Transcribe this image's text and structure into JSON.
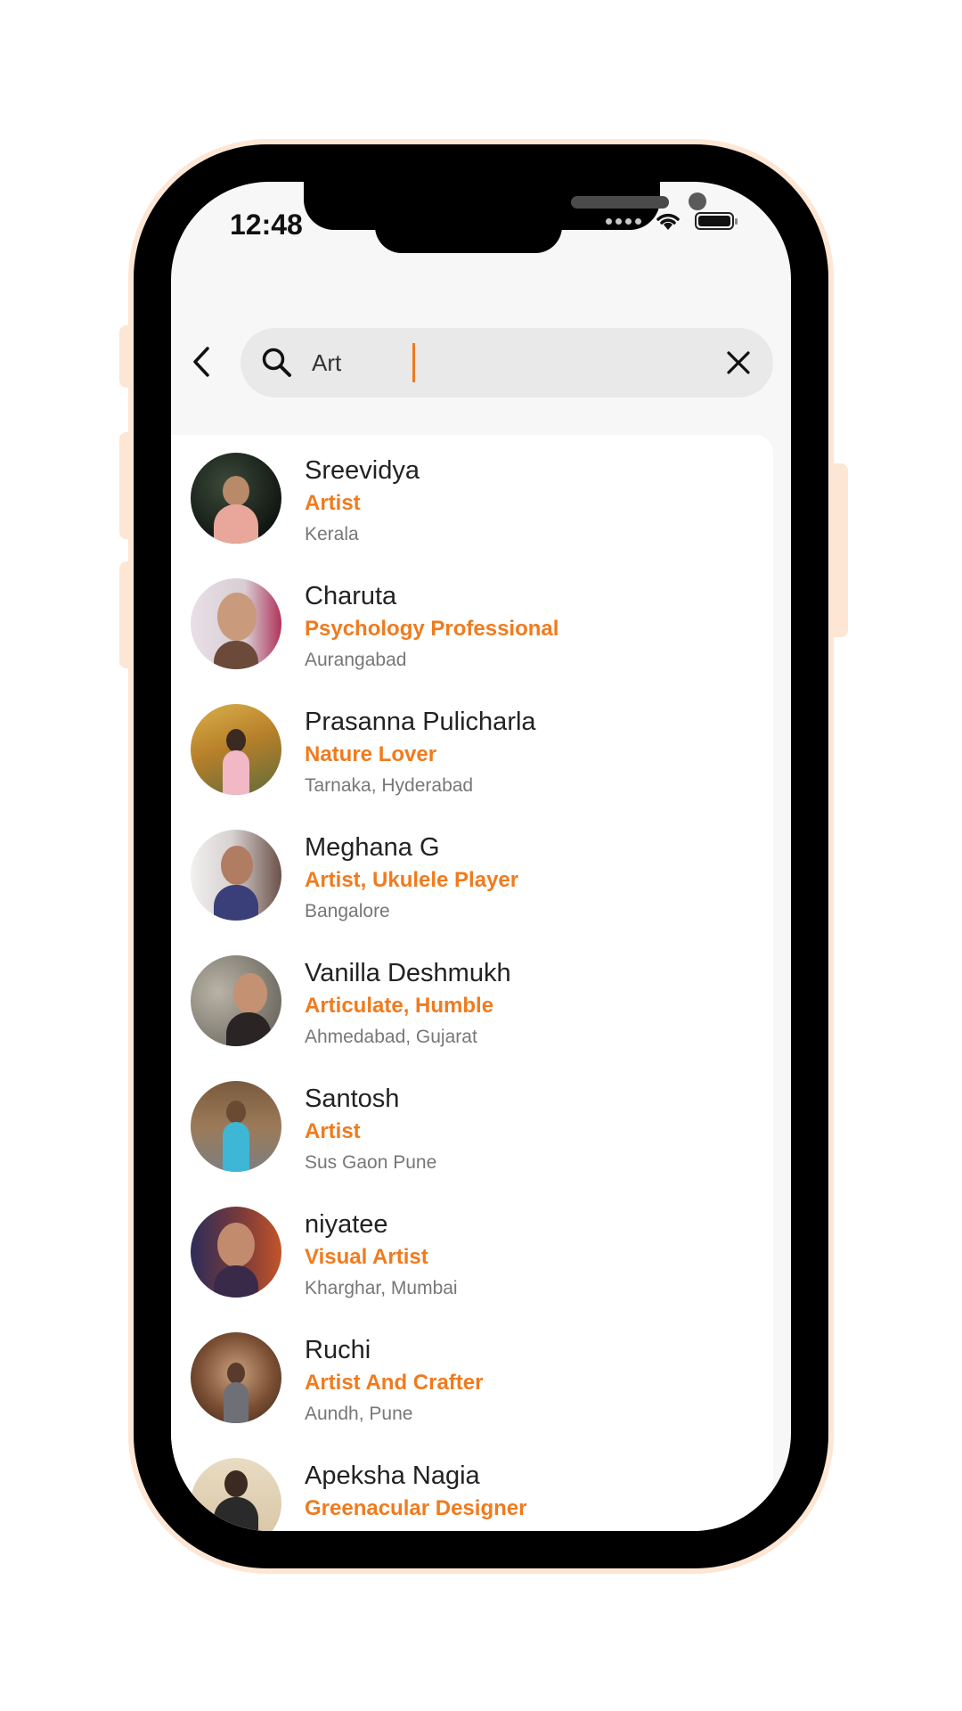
{
  "status_bar": {
    "time": "12:48"
  },
  "search": {
    "query": "Art",
    "placeholder": ""
  },
  "icons": {
    "back": "chevron-left-icon",
    "search": "search-icon",
    "clear": "close-icon"
  },
  "colors": {
    "accent": "#f07b1e",
    "name_text": "#222222",
    "location_text": "#777777",
    "search_bg": "#e9e9e9",
    "frame_glow": "#fde6d4"
  },
  "results": [
    {
      "name": "Sreevidya",
      "role": "Artist",
      "location": "Kerala"
    },
    {
      "name": "Charuta",
      "role": "Psychology Professional",
      "location": "Aurangabad"
    },
    {
      "name": "Prasanna Pulicharla",
      "role": "Nature Lover",
      "location": "Tarnaka, Hyderabad"
    },
    {
      "name": "Meghana G",
      "role": "Artist, Ukulele Player",
      "location": "Bangalore"
    },
    {
      "name": "Vanilla Deshmukh",
      "role": "Articulate, Humble",
      "location": "Ahmedabad, Gujarat"
    },
    {
      "name": "Santosh",
      "role": "Artist",
      "location": "Sus Gaon Pune"
    },
    {
      "name": "niyatee",
      "role": "Visual Artist",
      "location": "Kharghar, Mumbai"
    },
    {
      "name": "Ruchi",
      "role": "Artist And Crafter",
      "location": "Aundh, Pune"
    },
    {
      "name": "Apeksha Nagia",
      "role": "Greenacular Designer",
      "location": ""
    }
  ]
}
